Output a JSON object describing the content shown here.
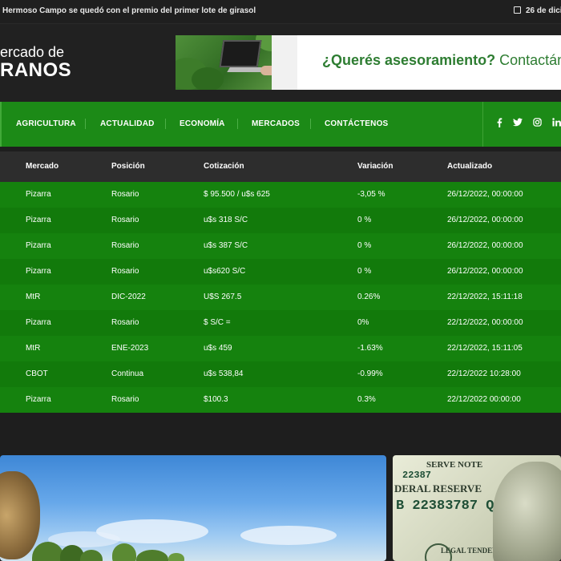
{
  "topbar": {
    "headline": "Hermoso Campo se quedó con el premio del primer lote de girasol",
    "date": "26 de dici"
  },
  "header": {
    "logo_line1": "ercado de",
    "logo_line2": "RANOS",
    "banner": {
      "bold": "¿Querés asesoramiento?",
      "rest": " Contactán"
    }
  },
  "nav": {
    "items": [
      "AGRICULTURA",
      "ACTUALIDAD",
      "ECONOMÍA",
      "MERCADOS",
      "CONTÁCTENOS"
    ],
    "social": [
      "f",
      "t",
      "ig",
      "in"
    ]
  },
  "table": {
    "headers": [
      "Mercado",
      "Posición",
      "Cotización",
      "Variación",
      "Actualizado"
    ],
    "rows": [
      [
        "Pizarra",
        "Rosario",
        "$ 95.500 / u$s 625",
        "-3,05 %",
        "26/12/2022, 00:00:00"
      ],
      [
        "Pizarra",
        "Rosario",
        "u$s 318 S/C",
        "0 %",
        "26/12/2022, 00:00:00"
      ],
      [
        "Pizarra",
        "Rosario",
        "u$s 387 S/C",
        "0 %",
        "26/12/2022, 00:00:00"
      ],
      [
        "Pizarra",
        "Rosario",
        "u$s620 S/C",
        "0 %",
        "26/12/2022, 00:00:00"
      ],
      [
        "MtR",
        "DIC-2022",
        "U$S 267.5",
        "0.26%",
        "22/12/2022, 15:11:18"
      ],
      [
        "Pizarra",
        "Rosario",
        "$ S/C =",
        "0%",
        "22/12/2022, 00:00:00"
      ],
      [
        "MtR",
        "ENE-2023",
        "u$s 459",
        "-1.63%",
        "22/12/2022, 15:11:05"
      ],
      [
        "CBOT",
        "Continua",
        "u$s 538,84",
        "-0.99%",
        "22/12/2022 10:28:00"
      ],
      [
        "Pizarra",
        "Rosario",
        "$100.3",
        "0.3%",
        "22/12/2022 00:00:00"
      ]
    ]
  },
  "news": {
    "bill_text_1": "SERVE NOTE",
    "bill_text_2": "DERAL RESERVE",
    "bill_text_3": "LEGAL TENDER",
    "serial_1": "22387",
    "serial_2": "B 22383787 Q"
  }
}
